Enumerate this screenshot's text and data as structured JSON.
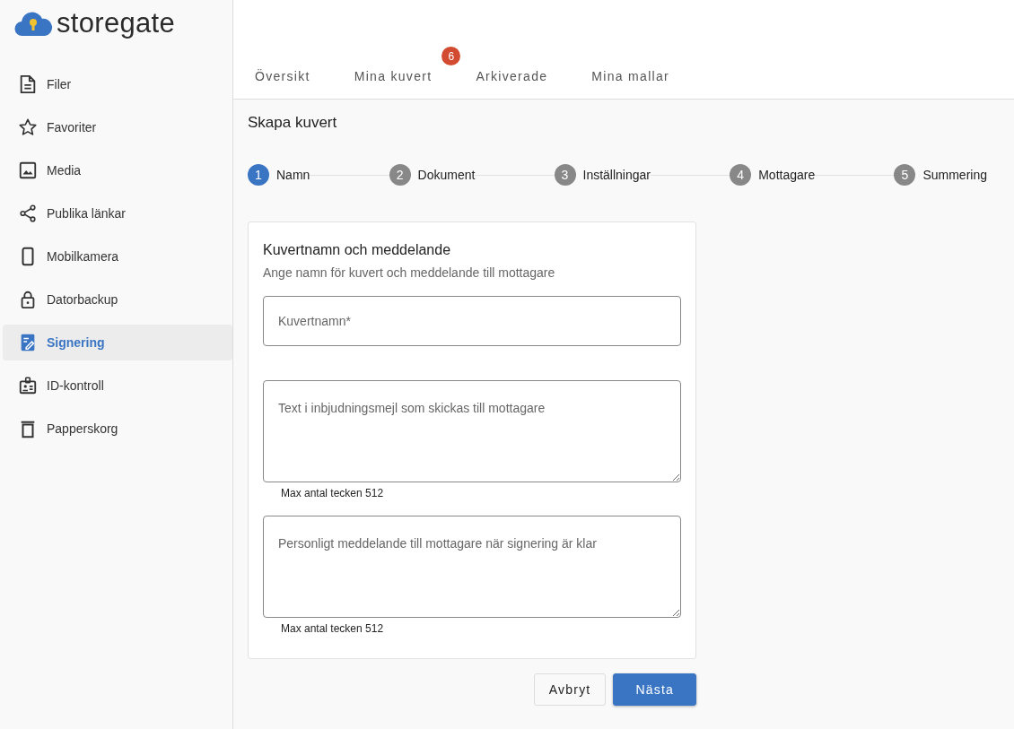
{
  "logo": {
    "text": "storegate"
  },
  "sidebar": {
    "items": [
      {
        "label": "Filer",
        "kind": "file",
        "selected": false
      },
      {
        "label": "Favoriter",
        "kind": "star",
        "selected": false
      },
      {
        "label": "Media",
        "kind": "image",
        "selected": false
      },
      {
        "label": "Publika länkar",
        "kind": "share",
        "selected": false
      },
      {
        "label": "Mobilkamera",
        "kind": "phone",
        "selected": false
      },
      {
        "label": "Datorbackup",
        "kind": "lock",
        "selected": false
      },
      {
        "label": "Signering",
        "kind": "sign",
        "selected": true
      },
      {
        "label": "ID-kontroll",
        "kind": "badge",
        "selected": false
      },
      {
        "label": "Papperskorg",
        "kind": "trash",
        "selected": false
      }
    ]
  },
  "tabs": [
    {
      "label": "Översikt",
      "selected": false
    },
    {
      "label": "Mina kuvert",
      "selected": false,
      "badge": "6"
    },
    {
      "label": "Arkiverade",
      "selected": false
    },
    {
      "label": "Mina mallar",
      "selected": false
    }
  ],
  "page_title": "Skapa kuvert",
  "stepper": [
    {
      "number": "1",
      "label": "Namn",
      "selected": true
    },
    {
      "number": "2",
      "label": "Dokument",
      "selected": false
    },
    {
      "number": "3",
      "label": "Inställningar",
      "selected": false
    },
    {
      "number": "4",
      "label": "Mottagare",
      "selected": false
    },
    {
      "number": "5",
      "label": "Summering",
      "selected": false
    }
  ],
  "card": {
    "title": "Kuvertnamn och meddelande",
    "subtitle": "Ange namn för kuvert och meddelande till mottagare",
    "fields": [
      {
        "kind": "input",
        "placeholder": "Kuvertnamn*"
      },
      {
        "kind": "textarea",
        "placeholder": "Text i inbjudningsmejl som skickas till mottagare",
        "hint": "Max antal tecken 512"
      },
      {
        "kind": "textarea",
        "placeholder": "Personligt meddelande till mottagare när signering är klar",
        "hint": "Max antal tecken 512"
      }
    ]
  },
  "buttons": [
    {
      "label": "Avbryt",
      "kind": "secondary"
    },
    {
      "label": "Nästa",
      "kind": "primary"
    }
  ]
}
